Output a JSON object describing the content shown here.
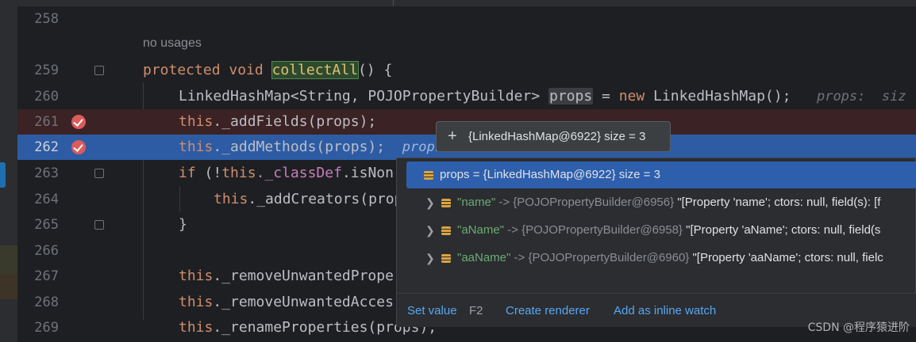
{
  "editor": {
    "usages_label": "no usages",
    "lines": [
      {
        "num": "258"
      },
      {
        "num": "259",
        "kw": "protected void ",
        "method": "collectAll",
        "rest": "() {"
      },
      {
        "num": "260",
        "pre": "LinkedHashMap<String, POJOPropertyBuilder> ",
        "var": "props",
        "mid": " = ",
        "kw": "new",
        "post": " LinkedHashMap();",
        "hint": "props:  siz"
      },
      {
        "num": "261",
        "this": "this",
        "rest": "._addFields(props);"
      },
      {
        "num": "262",
        "this": "this",
        "rest": "._addMethods(props);",
        "hint": "props"
      },
      {
        "num": "263",
        "kw": "if",
        "pre": " (!",
        "this": "this",
        "fld": "._classDef",
        "rest": ".isNon"
      },
      {
        "num": "264",
        "this": "this",
        "rest": "._addCreators(prop"
      },
      {
        "num": "265",
        "rest": "}"
      },
      {
        "num": "266"
      },
      {
        "num": "267",
        "this": "this",
        "rest": "._removeUnwantedPrope"
      },
      {
        "num": "268",
        "this": "this",
        "rest": "._removeUnwantedAcces"
      },
      {
        "num": "269",
        "this": "this",
        "rest": "._renameProperties(props);"
      }
    ]
  },
  "tooltip": {
    "plus": "+",
    "text": "{LinkedHashMap@6922}  size = 3"
  },
  "popup": {
    "root": {
      "label": "props = {LinkedHashMap@6922}  size = 3"
    },
    "entries": [
      {
        "key": "\"name\"",
        "arrow": " -> ",
        "ref": "{POJOPropertyBuilder@6956}",
        "value": " \"[Property 'name'; ctors: null, field(s): [f"
      },
      {
        "key": "\"aName\"",
        "arrow": " -> ",
        "ref": "{POJOPropertyBuilder@6958}",
        "value": " \"[Property 'aName'; ctors: null, field(s"
      },
      {
        "key": "\"aaName\"",
        "arrow": " -> ",
        "ref": "{POJOPropertyBuilder@6960}",
        "value": " \"[Property 'aaName'; ctors: null, fielc"
      }
    ],
    "footer": {
      "set_value": "Set value",
      "set_value_key": "F2",
      "create_renderer": "Create renderer",
      "add_inline_watch": "Add as inline watch"
    }
  },
  "watermark": "CSDN @程序猿进阶",
  "icons": {
    "breakpoint": "breakpoint-icon",
    "fold": "fold-icon",
    "expand": "chevron-right-icon",
    "field": "field-icon"
  },
  "colors": {
    "keyword": "#cf8e6d",
    "field": "#c77dbb",
    "string": "#6aab73",
    "link": "#56a8f5",
    "exec_line": "#2d5ca5",
    "breakpoint_line": "#3b2224"
  }
}
